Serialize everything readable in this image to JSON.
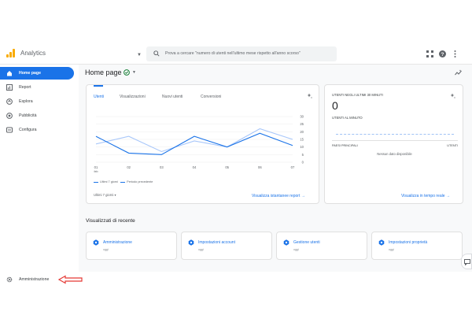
{
  "header": {
    "app_title": "Analytics",
    "search_placeholder": "Prova a cercare \"numero di utenti nell'ultimo mese rispetto all'anno scorso\""
  },
  "sidebar": {
    "items": [
      {
        "label": "Home page",
        "icon": "home-icon",
        "active": true
      },
      {
        "label": "Report",
        "icon": "report-icon",
        "active": false
      },
      {
        "label": "Esplora",
        "icon": "explore-icon",
        "active": false
      },
      {
        "label": "Pubblicità",
        "icon": "advertising-icon",
        "active": false
      },
      {
        "label": "Configura",
        "icon": "configure-icon",
        "active": false
      }
    ],
    "admin_label": "Amministrazione"
  },
  "main": {
    "page_title": "Home page",
    "chart_card": {
      "tabs": [
        "Utenti",
        "Visualizzazioni",
        "Nuovi utenti",
        "Conversioni"
      ],
      "legend_current": "Ultimi 7 giorni",
      "legend_previous": "Periodo precedente",
      "date_range": "Ultimi 7 giorni ▾",
      "link": "Visualizza istantanee report →"
    },
    "realtime_card": {
      "header": "UTENTI NEGLI ULTIMI 30 MINUTI",
      "value": "0",
      "subheader": "UTENTI AL MINUTO",
      "col_left": "PAESI PRINCIPALI",
      "col_right": "UTENTI",
      "empty": "Nessun dato disponibile",
      "link": "Visualizza in tempo reale →"
    },
    "recent": {
      "title": "Visualizzati di recente",
      "items": [
        {
          "name": "Amministrazione",
          "sub": "oggi"
        },
        {
          "name": "Impostazioni account",
          "sub": "oggi"
        },
        {
          "name": "Gestione utenti",
          "sub": "oggi"
        },
        {
          "name": "Impostazioni proprietà",
          "sub": "oggi"
        }
      ]
    }
  },
  "colors": {
    "accent": "#1a73e8",
    "logo": "#f9ab00",
    "arrow": "#e53935",
    "previous_series": "#a8c7fa"
  },
  "chart_data": {
    "type": "line",
    "x": [
      "01",
      "02",
      "03",
      "04",
      "05",
      "06",
      "07"
    ],
    "x_sublabel": "feb",
    "yticks": [
      0,
      5,
      10,
      15,
      20,
      25,
      30
    ],
    "ylim": [
      0,
      30
    ],
    "series": [
      {
        "name": "Ultimi 7 giorni",
        "values": [
          17,
          6,
          5,
          17,
          10,
          19,
          11
        ]
      },
      {
        "name": "Periodo precedente",
        "values": [
          12,
          17,
          7,
          14,
          10,
          22,
          15
        ]
      }
    ]
  }
}
